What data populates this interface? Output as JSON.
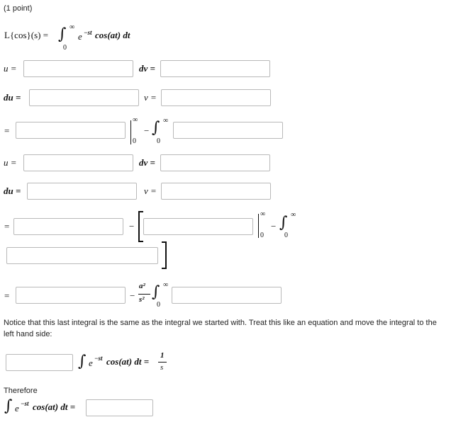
{
  "header": {
    "points": "(1 point)"
  },
  "laplace": {
    "lhs": "L{cos}(s) =",
    "upper": "∞",
    "lower": "0",
    "integrand_e": "e",
    "exponent": "−st",
    "integrand_rest": "cos(at) dt"
  },
  "labels": {
    "u": "u =",
    "dv": "dv =",
    "du": "du =",
    "v": "v =",
    "eq": "=",
    "minus": "−",
    "inf": "∞",
    "zero": "0",
    "frac_num": "a²",
    "frac_den": "s²"
  },
  "inputs": {
    "u1": "",
    "dv1": "",
    "du1": "",
    "v1": "",
    "r3a": "",
    "r3b": "",
    "u2": "",
    "dv2": "",
    "du2": "",
    "v2": "",
    "r6a": "",
    "r6b": "",
    "r6c": "",
    "r8a": "",
    "r8b": "",
    "lhs_coef": "",
    "final": ""
  },
  "notice": "Notice that this last integral is the same as the integral we started with. Treat this like an equation and move the integral to the left hand side:",
  "eq_rhs": {
    "num": "1",
    "den": "s",
    "eq": "="
  },
  "therefore": "Therefore",
  "final_eq": {
    "e": "e",
    "exp": "−st",
    "rest": "cos(at) dt ="
  }
}
